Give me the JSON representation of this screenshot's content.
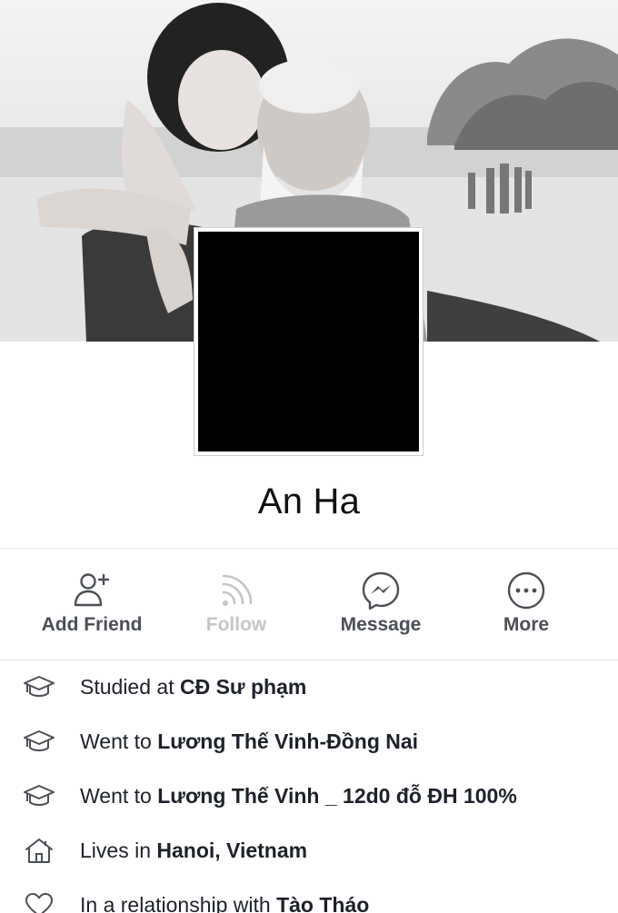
{
  "profile": {
    "name": "An Ha"
  },
  "actions": [
    {
      "label": "Add Friend",
      "icon": "add-friend-icon",
      "enabled": true
    },
    {
      "label": "Follow",
      "icon": "follow-icon",
      "enabled": false
    },
    {
      "label": "Message",
      "icon": "messenger-icon",
      "enabled": true
    },
    {
      "label": "More",
      "icon": "more-icon",
      "enabled": true
    }
  ],
  "intro": [
    {
      "icon": "graduation-cap-icon",
      "prefix": "Studied at ",
      "value": "CĐ Sư phạm"
    },
    {
      "icon": "graduation-cap-icon",
      "prefix": "Went to ",
      "value": "Lương Thế Vinh-Đồng Nai"
    },
    {
      "icon": "graduation-cap-icon",
      "prefix": "Went to ",
      "value": "Lương Thế Vinh _ 12d0 đỗ ĐH 100%"
    },
    {
      "icon": "home-icon",
      "prefix": "Lives in ",
      "value": "Hanoi, Vietnam"
    },
    {
      "icon": "heart-icon",
      "prefix": "In a relationship with ",
      "value": "Tào Tháo"
    }
  ],
  "colors": {
    "label": "#4b4f56",
    "disabled": "#c4c6ca",
    "text": "#1d2129"
  }
}
